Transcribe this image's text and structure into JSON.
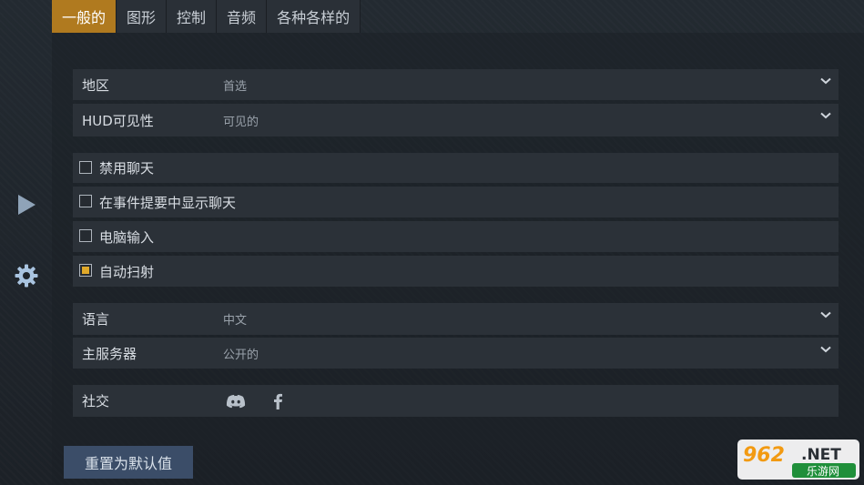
{
  "tabs": [
    {
      "label": "一般的",
      "active": true
    },
    {
      "label": "图形",
      "active": false
    },
    {
      "label": "控制",
      "active": false
    },
    {
      "label": "音频",
      "active": false
    },
    {
      "label": "各种各样的",
      "active": false
    }
  ],
  "sidebar": {
    "items": [
      {
        "icon": "play-icon"
      },
      {
        "icon": "gear-icon"
      }
    ]
  },
  "settings": {
    "region": {
      "label": "地区",
      "value": "首选"
    },
    "hud": {
      "label": "HUD可见性",
      "value": "可见的"
    },
    "checkboxes": [
      {
        "label": "禁用聊天",
        "checked": false
      },
      {
        "label": "在事件提要中显示聊天",
        "checked": false
      },
      {
        "label": "电脑输入",
        "checked": false
      },
      {
        "label": "自动扫射",
        "checked": true
      }
    ],
    "language": {
      "label": "语言",
      "value": "中文"
    },
    "server": {
      "label": "主服务器",
      "value": "公开的"
    },
    "social": {
      "label": "社交",
      "icons": [
        "discord-icon",
        "facebook-icon"
      ]
    }
  },
  "reset_label": "重置为默认值",
  "watermark": {
    "brand": "962",
    "tld": ".NET",
    "site": "乐游网"
  },
  "colors": {
    "accent": "#b07a1f",
    "checkbox_fill": "#e0a92a",
    "reset_button": "#3b4d68"
  }
}
